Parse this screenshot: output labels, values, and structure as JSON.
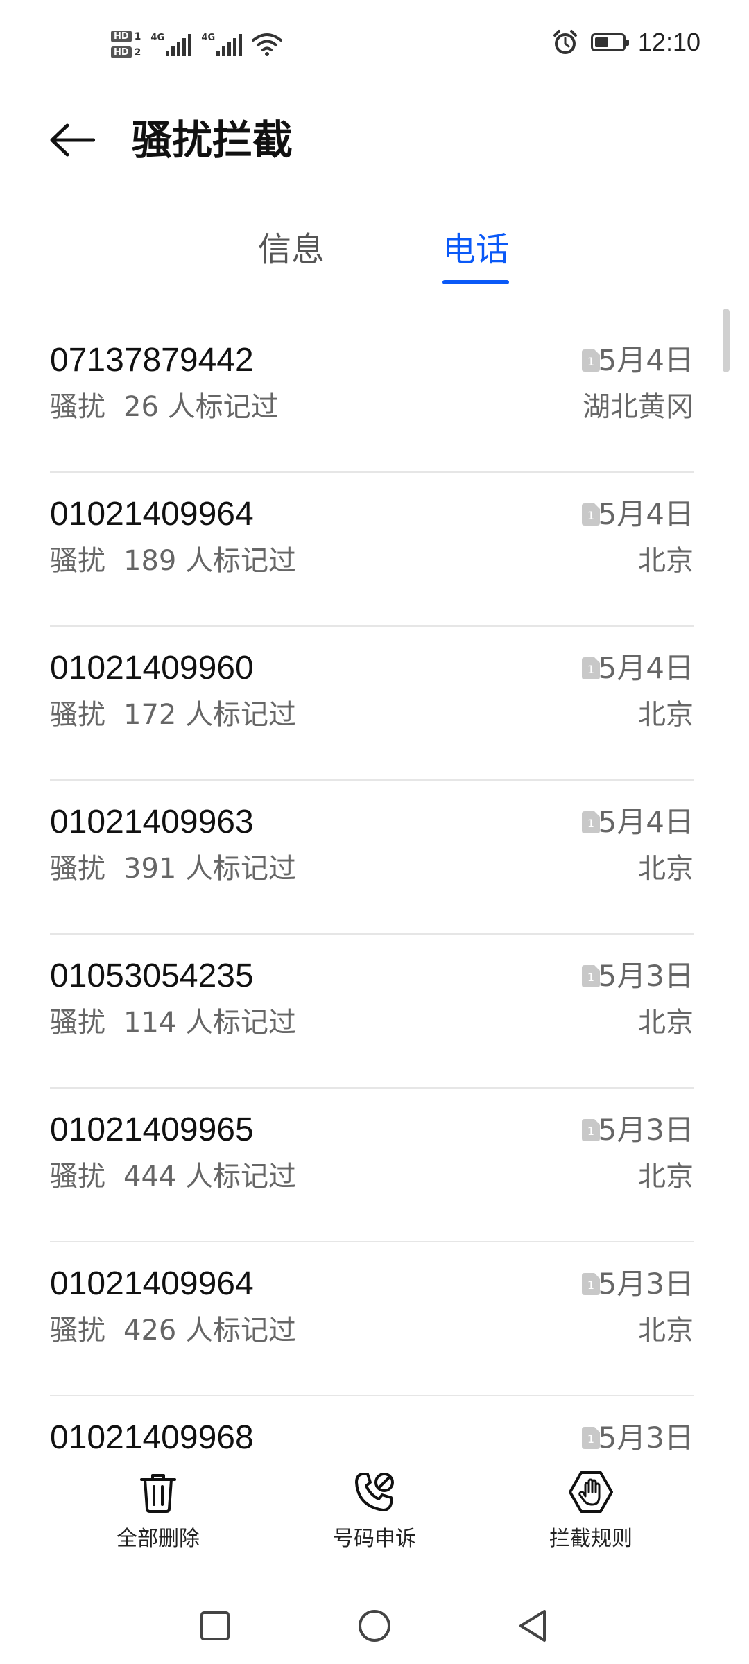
{
  "status_bar": {
    "sim1_label": "HD",
    "sim1_num": "1",
    "sim2_label": "HD",
    "sim2_num": "2",
    "network1": "4G",
    "network2": "4G",
    "battery_level": 0.5,
    "time": "12:10"
  },
  "header": {
    "title": "骚扰拦截",
    "back_icon": "arrow-left-icon"
  },
  "tabs": [
    {
      "label": "信息",
      "active": false
    },
    {
      "label": "电话",
      "active": true
    }
  ],
  "accent_color": "#0a59f7",
  "calls": [
    {
      "number": "07137879442",
      "tag": "骚扰",
      "count": "26 人标记过",
      "sim": "1",
      "date": "5月4日",
      "location": "湖北黄冈"
    },
    {
      "number": "01021409964",
      "tag": "骚扰",
      "count": "189 人标记过",
      "sim": "1",
      "date": "5月4日",
      "location": "北京"
    },
    {
      "number": "01021409960",
      "tag": "骚扰",
      "count": "172 人标记过",
      "sim": "1",
      "date": "5月4日",
      "location": "北京"
    },
    {
      "number": "01021409963",
      "tag": "骚扰",
      "count": "391 人标记过",
      "sim": "1",
      "date": "5月4日",
      "location": "北京"
    },
    {
      "number": "01053054235",
      "tag": "骚扰",
      "count": "114 人标记过",
      "sim": "1",
      "date": "5月3日",
      "location": "北京"
    },
    {
      "number": "01021409965",
      "tag": "骚扰",
      "count": "444 人标记过",
      "sim": "1",
      "date": "5月3日",
      "location": "北京"
    },
    {
      "number": "01021409964",
      "tag": "骚扰",
      "count": "426 人标记过",
      "sim": "1",
      "date": "5月3日",
      "location": "北京"
    },
    {
      "number": "01021409968",
      "tag": "",
      "count": "",
      "sim": "1",
      "date": "5月3日",
      "location": ""
    }
  ],
  "toolbar": {
    "delete_all_label": "全部删除",
    "appeal_label": "号码申诉",
    "rules_label": "拦截规则"
  }
}
